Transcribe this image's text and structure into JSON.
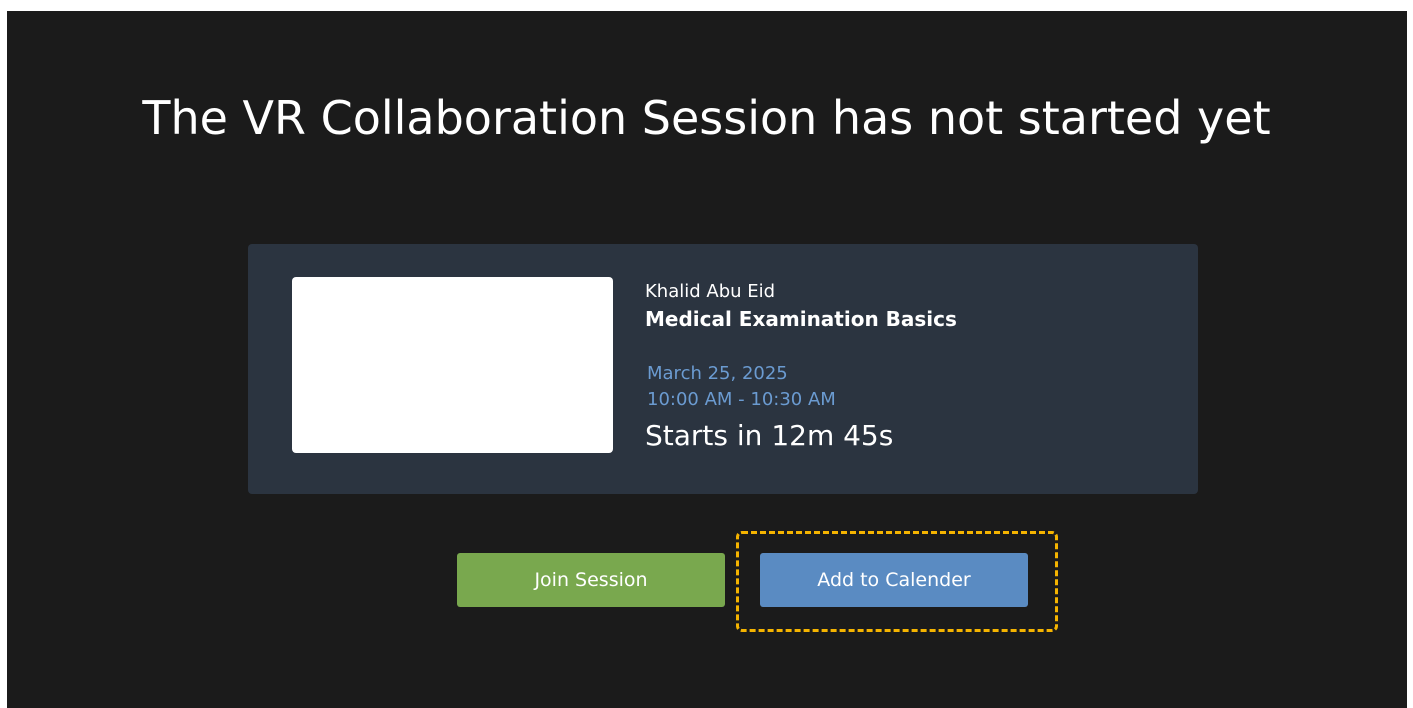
{
  "page": {
    "title": "The VR Collaboration Session has not started yet"
  },
  "session": {
    "host": "Khalid Abu Eid",
    "course": "Medical Examination Basics",
    "date": "March 25, 2025",
    "time": "10:00 AM - 10:30 AM",
    "countdown": "Starts in 12m 45s"
  },
  "actions": {
    "join_label": "Join Session",
    "calendar_label": "Add to Calender"
  },
  "colors": {
    "background": "#1b1b1b",
    "card": "#2b3440",
    "date_text": "#6b9bd1",
    "join_button": "#79a84e",
    "calendar_button": "#5a8bc2",
    "highlight": "#f5b400"
  }
}
